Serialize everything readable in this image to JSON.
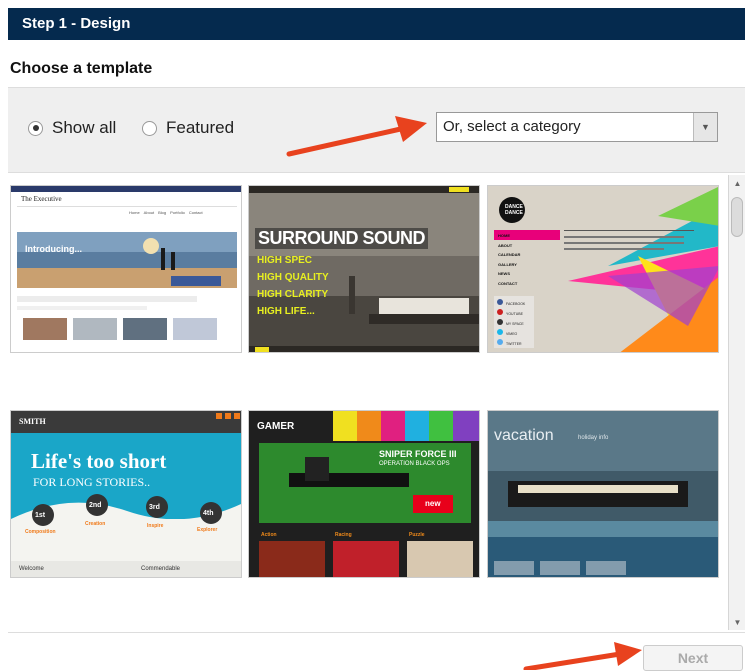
{
  "header": {
    "title": "Step 1 - Design"
  },
  "section": {
    "subtitle": "Choose a template"
  },
  "filters": {
    "show_all_label": "Show all",
    "featured_label": "Featured",
    "selected": "Show all",
    "category_select_value": "Or, select a category"
  },
  "templates": [
    {
      "brand": "The Executive",
      "headline": "Introducing...",
      "nav": [
        "Home",
        "About",
        "Blog",
        "Portfolio",
        "Contact"
      ]
    },
    {
      "headline": "SURROUND SOUND",
      "lines": [
        "HIGH SPEC",
        "HIGH QUALITY",
        "HIGH CLARITY",
        "HIGH LIFE..."
      ]
    },
    {
      "logo": "DANCE DANCE",
      "menu": [
        "HOME",
        "ABOUT",
        "CALENDAR",
        "GALLERY",
        "NEWS",
        "CONTACT"
      ],
      "social": [
        "FACEBOOK",
        "YOUTUBE",
        "MY SPACE",
        "VIMEO",
        "TWITTER"
      ]
    },
    {
      "brand": "SMITH",
      "headline": "Life's too short",
      "subheadline": "FOR LONG STORIES..",
      "steps": [
        "1st",
        "2nd",
        "3rd",
        "4th"
      ],
      "step_labels": [
        "Composition",
        "Creation",
        "Inspire",
        "Explorer"
      ],
      "footer": [
        "Welcome",
        "Commendable"
      ]
    },
    {
      "brand": "GAMER",
      "banner_title": "SNIPER FORCE III",
      "banner_sub": "OPERATION BLACK OPS",
      "badge": "new",
      "tiles": [
        "Action",
        "Racing",
        "Puzzle"
      ]
    },
    {
      "brand": "vacation",
      "tagline": "holiday info"
    }
  ],
  "colors": {
    "header_bg": "#052a4e",
    "annotation_arrow": "#e8421e"
  },
  "footer": {
    "next_label": "Next"
  }
}
